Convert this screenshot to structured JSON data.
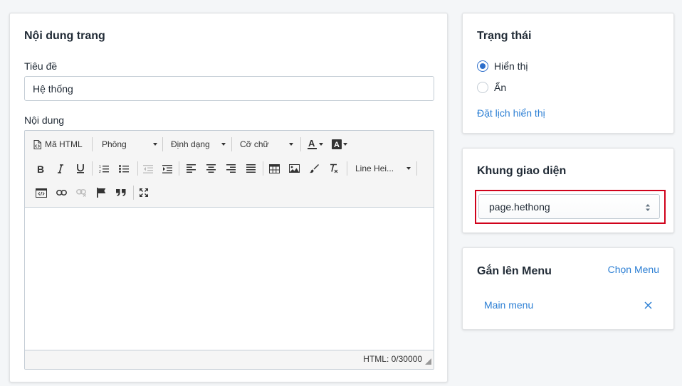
{
  "content": {
    "title": "Nội dung trang",
    "title_label": "Tiêu đề",
    "title_value": "Hệ thống",
    "body_label": "Nội dung",
    "toolbar": {
      "html_btn": "Mã HTML",
      "font_dd": "Phông",
      "format_dd": "Định dạng",
      "size_dd": "Cỡ chữ",
      "lineheight_dd": "Line Hei..."
    },
    "status": "HTML: 0/30000"
  },
  "status_card": {
    "title": "Trạng thái",
    "options": [
      "Hiển thị",
      "Ẩn"
    ],
    "selected": "Hiển thị",
    "schedule_link": "Đặt lịch hiển thị"
  },
  "template_card": {
    "title": "Khung giao diện",
    "selected": "page.hethong"
  },
  "menu_card": {
    "title": "Gắn lên Menu",
    "choose_link": "Chọn Menu",
    "items": [
      "Main menu"
    ]
  },
  "colors": {
    "accent": "#2c6ecb",
    "link": "#2c7fd4",
    "highlight": "#d0021b"
  }
}
